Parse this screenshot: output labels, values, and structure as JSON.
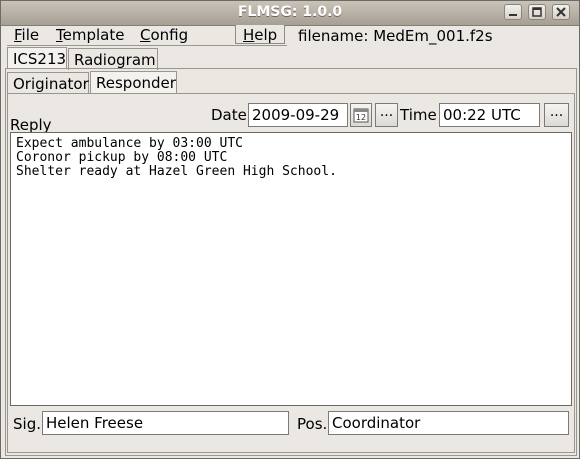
{
  "window": {
    "title": "FLMSG: 1.0.0"
  },
  "menus": [
    {
      "label": "File",
      "accel": "F",
      "rest": "ile"
    },
    {
      "label": "Template",
      "accel": "T",
      "rest": "emplate"
    },
    {
      "label": "Config",
      "accel": "C",
      "rest": "onfig"
    },
    {
      "label": "Help",
      "accel": "H",
      "rest": "elp"
    }
  ],
  "filename_text": "filename: MedEm_001.f2s",
  "tabs_top": [
    "ICS213",
    "Radiogram"
  ],
  "tabs_sub": [
    "Originator",
    "Responder"
  ],
  "responder": {
    "reply_label": "Reply",
    "date_label": "Date",
    "date_value": "2009-09-29",
    "calendar_icon_text": "12",
    "ellipsis": "...",
    "time_label": "Time",
    "time_value": "00:22 UTC",
    "message_lines": [
      "Expect ambulance by 03:00 UTC",
      "Coronor pickup by 08:00 UTC",
      "Shelter ready at Hazel Green High School."
    ],
    "sig_label": "Sig.",
    "sig_value": "Helen Freese",
    "pos_label": "Pos.",
    "pos_value": "Coordinator"
  },
  "colors": {
    "titlebar": "#b3ada3",
    "window_bg": "#ebe8e4",
    "field_bg": "#ffffff"
  }
}
